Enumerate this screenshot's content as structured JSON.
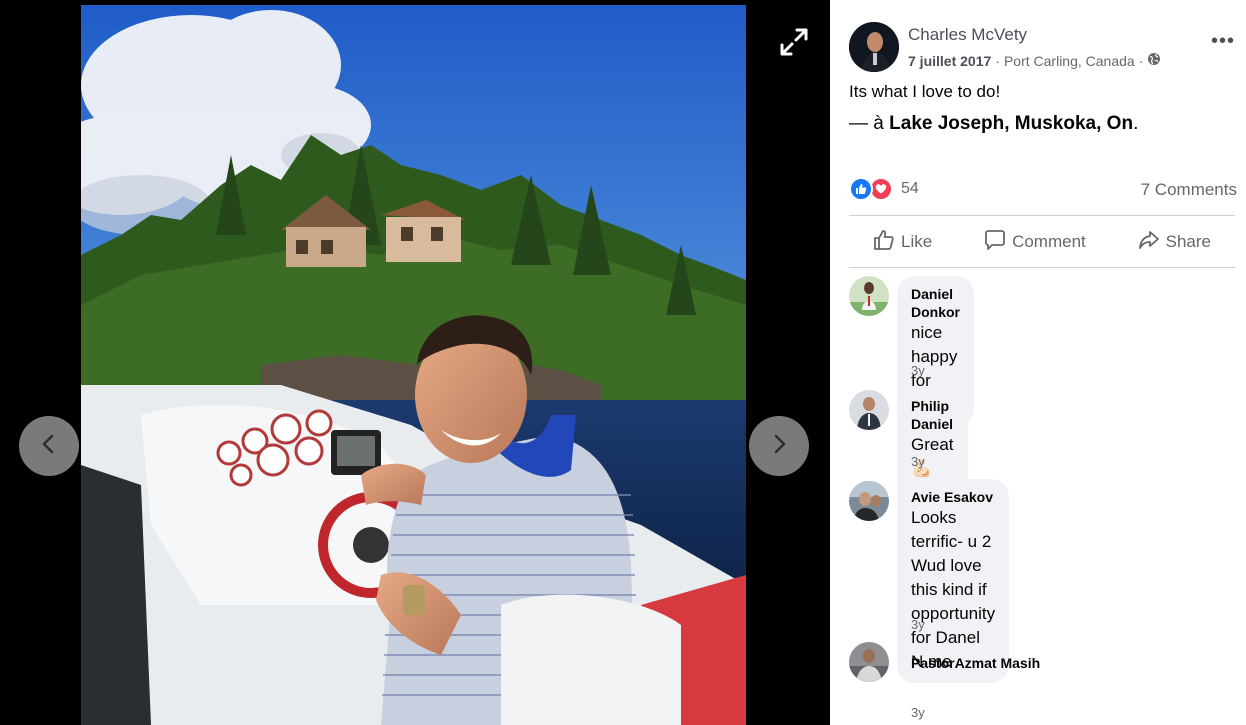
{
  "viewer": {
    "prev_icon": "chevron-left-icon",
    "next_icon": "chevron-right-icon",
    "expand_icon": "expand-icon",
    "photo_alt": "Man smiling while driving a boat on a lake"
  },
  "post": {
    "author": "Charles McVety",
    "date": "7 juillet 2017",
    "place": "Port Carling, Canada",
    "separator": "·",
    "privacy_icon": "globe-icon",
    "more_label": "•••",
    "text": "Its what I love to do!",
    "location_prefix": "— à",
    "location_name": "Lake Joseph, Muskoka, On",
    "location_suffix": ".",
    "reaction_count": "54",
    "comments_label": "7 Comments"
  },
  "actions": {
    "like": "Like",
    "comment": "Comment",
    "share": "Share"
  },
  "comments": [
    {
      "name": "Daniel Donkor",
      "lines": [
        "nice",
        "happy for you"
      ],
      "time": "3y"
    },
    {
      "name": "Philip Daniel",
      "lines": [
        "Great💪🏻☄️✝"
      ],
      "time": "3y"
    },
    {
      "name": "Avie Esakov",
      "lines": [
        "Looks terrific- u 2",
        "Wud love this kind if opportunity",
        "for Danel",
        "N me"
      ],
      "time": "3y"
    },
    {
      "name": "PastorAzmat Masih",
      "lines": [],
      "time": "3y"
    }
  ],
  "colors": {
    "accent": "#1877f2",
    "love": "#f33e58",
    "bubble": "#f0f2f5",
    "secondary_text": "#65676b"
  }
}
